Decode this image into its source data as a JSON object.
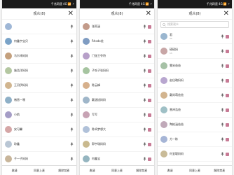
{
  "screens": [
    {
      "status": "千兆网速 4G 📶 ⚡",
      "title": "观众(8)",
      "rows": [
        {
          "name": "",
          "color": "#9fb7d6"
        },
        {
          "name": "何鑫宇宝贝",
          "color": "#7aa3c8"
        },
        {
          "name": "马尔泽妈妈",
          "color": "#c4a07d"
        },
        {
          "name": "施浩洋妈妈",
          "color": "#b4c7a1"
        },
        {
          "name": "王羽伊妈妈",
          "color": "#d1b58f"
        },
        {
          "name": "褚晋一嘿",
          "color": "#8fb0c7"
        },
        {
          "name": "小航",
          "color": "#a59dc6"
        },
        {
          "name": "安可馨",
          "color": "#d5a6a6"
        },
        {
          "name": "琼鑫",
          "color": "#b9c6d4"
        },
        {
          "name": "子一子妈妈",
          "color": "#c8b59a"
        },
        {
          "name": "张婉辰",
          "color": "#9bc4b8"
        }
      ],
      "buttons": [
        "邀请",
        "同意上麦",
        "解除禁麦"
      ]
    },
    {
      "status": "千兆网速 4G 📶 ⚡",
      "title": "观众(8)",
      "rows": [
        {
          "name": "张雨涵",
          "color": "#c39b8a"
        },
        {
          "name": "Rhodo爸",
          "color": "#7f9cc2"
        },
        {
          "name": "门张王夸特",
          "color": "#b7a0c9"
        },
        {
          "name": "子吃子张妈妈",
          "color": "#a6c4a0"
        },
        {
          "name": "陈云峰",
          "color": "#d6b08c"
        },
        {
          "name": "戴涵旭妈妈",
          "color": "#9fb6c9"
        },
        {
          "name": "写写",
          "color": "#c7a3b4"
        },
        {
          "name": "陈卓梦想大",
          "color": "#b0c1d9"
        },
        {
          "name": "郭宇瑞妈妈",
          "color": "#c9b98e"
        },
        {
          "name": "何鑫宝",
          "color": "#95b5c0"
        },
        {
          "name": "何鑫宇宝贝",
          "color": "#a7b2d2"
        }
      ],
      "buttons": [
        "邀请",
        "同意上麦",
        "解除禁麦"
      ]
    },
    {
      "status": "千兆网速 4G 📶 ⚡",
      "title": "观众(8)",
      "search_placeholder": "搜索观众",
      "rows": [
        {
          "name": "君",
          "sub": "2h",
          "color": "#9ab6cf"
        },
        {
          "name": "硕硕妈",
          "sub": "1h",
          "color": "#c8a6a6"
        },
        {
          "name": "雯米爸爸",
          "color": "#a6c1a6"
        },
        {
          "name": "赵佳璐妈妈",
          "color": "#b8a6cf"
        },
        {
          "name": "戴尚萌爸爸",
          "color": "#d2b48f"
        },
        {
          "name": "曾泽浩爸",
          "color": "#9fc0c6"
        },
        {
          "name": "陶柏涵爸爸",
          "color": "#c0a9b9"
        },
        {
          "name": "方一栋",
          "color": "#a6b5d6"
        },
        {
          "name": "何宜聪妈妈",
          "color": "#c9bb98"
        },
        {
          "name": "谢佳盈",
          "color": "#9bc2b0"
        }
      ],
      "buttons": [
        "邀请",
        "同意上麦",
        "解除禁麦"
      ]
    }
  ]
}
